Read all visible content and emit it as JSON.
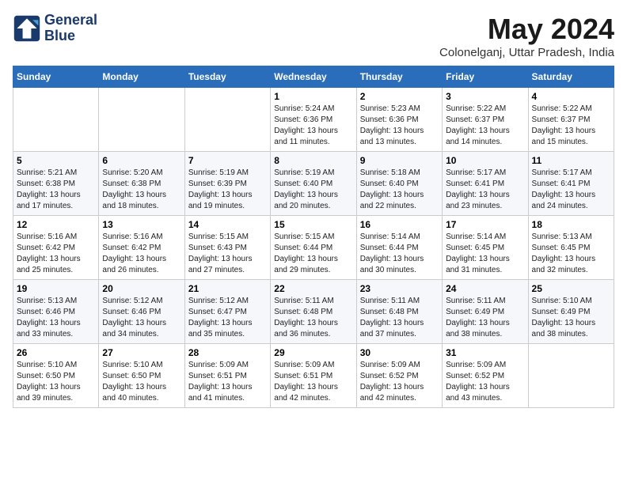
{
  "header": {
    "logo_line1": "General",
    "logo_line2": "Blue",
    "month_title": "May 2024",
    "location": "Colonelganj, Uttar Pradesh, India"
  },
  "days_of_week": [
    "Sunday",
    "Monday",
    "Tuesday",
    "Wednesday",
    "Thursday",
    "Friday",
    "Saturday"
  ],
  "weeks": [
    [
      {
        "day": "",
        "info": ""
      },
      {
        "day": "",
        "info": ""
      },
      {
        "day": "",
        "info": ""
      },
      {
        "day": "1",
        "info": "Sunrise: 5:24 AM\nSunset: 6:36 PM\nDaylight: 13 hours and 11 minutes."
      },
      {
        "day": "2",
        "info": "Sunrise: 5:23 AM\nSunset: 6:36 PM\nDaylight: 13 hours and 13 minutes."
      },
      {
        "day": "3",
        "info": "Sunrise: 5:22 AM\nSunset: 6:37 PM\nDaylight: 13 hours and 14 minutes."
      },
      {
        "day": "4",
        "info": "Sunrise: 5:22 AM\nSunset: 6:37 PM\nDaylight: 13 hours and 15 minutes."
      }
    ],
    [
      {
        "day": "5",
        "info": "Sunrise: 5:21 AM\nSunset: 6:38 PM\nDaylight: 13 hours and 17 minutes."
      },
      {
        "day": "6",
        "info": "Sunrise: 5:20 AM\nSunset: 6:38 PM\nDaylight: 13 hours and 18 minutes."
      },
      {
        "day": "7",
        "info": "Sunrise: 5:19 AM\nSunset: 6:39 PM\nDaylight: 13 hours and 19 minutes."
      },
      {
        "day": "8",
        "info": "Sunrise: 5:19 AM\nSunset: 6:40 PM\nDaylight: 13 hours and 20 minutes."
      },
      {
        "day": "9",
        "info": "Sunrise: 5:18 AM\nSunset: 6:40 PM\nDaylight: 13 hours and 22 minutes."
      },
      {
        "day": "10",
        "info": "Sunrise: 5:17 AM\nSunset: 6:41 PM\nDaylight: 13 hours and 23 minutes."
      },
      {
        "day": "11",
        "info": "Sunrise: 5:17 AM\nSunset: 6:41 PM\nDaylight: 13 hours and 24 minutes."
      }
    ],
    [
      {
        "day": "12",
        "info": "Sunrise: 5:16 AM\nSunset: 6:42 PM\nDaylight: 13 hours and 25 minutes."
      },
      {
        "day": "13",
        "info": "Sunrise: 5:16 AM\nSunset: 6:42 PM\nDaylight: 13 hours and 26 minutes."
      },
      {
        "day": "14",
        "info": "Sunrise: 5:15 AM\nSunset: 6:43 PM\nDaylight: 13 hours and 27 minutes."
      },
      {
        "day": "15",
        "info": "Sunrise: 5:15 AM\nSunset: 6:44 PM\nDaylight: 13 hours and 29 minutes."
      },
      {
        "day": "16",
        "info": "Sunrise: 5:14 AM\nSunset: 6:44 PM\nDaylight: 13 hours and 30 minutes."
      },
      {
        "day": "17",
        "info": "Sunrise: 5:14 AM\nSunset: 6:45 PM\nDaylight: 13 hours and 31 minutes."
      },
      {
        "day": "18",
        "info": "Sunrise: 5:13 AM\nSunset: 6:45 PM\nDaylight: 13 hours and 32 minutes."
      }
    ],
    [
      {
        "day": "19",
        "info": "Sunrise: 5:13 AM\nSunset: 6:46 PM\nDaylight: 13 hours and 33 minutes."
      },
      {
        "day": "20",
        "info": "Sunrise: 5:12 AM\nSunset: 6:46 PM\nDaylight: 13 hours and 34 minutes."
      },
      {
        "day": "21",
        "info": "Sunrise: 5:12 AM\nSunset: 6:47 PM\nDaylight: 13 hours and 35 minutes."
      },
      {
        "day": "22",
        "info": "Sunrise: 5:11 AM\nSunset: 6:48 PM\nDaylight: 13 hours and 36 minutes."
      },
      {
        "day": "23",
        "info": "Sunrise: 5:11 AM\nSunset: 6:48 PM\nDaylight: 13 hours and 37 minutes."
      },
      {
        "day": "24",
        "info": "Sunrise: 5:11 AM\nSunset: 6:49 PM\nDaylight: 13 hours and 38 minutes."
      },
      {
        "day": "25",
        "info": "Sunrise: 5:10 AM\nSunset: 6:49 PM\nDaylight: 13 hours and 38 minutes."
      }
    ],
    [
      {
        "day": "26",
        "info": "Sunrise: 5:10 AM\nSunset: 6:50 PM\nDaylight: 13 hours and 39 minutes."
      },
      {
        "day": "27",
        "info": "Sunrise: 5:10 AM\nSunset: 6:50 PM\nDaylight: 13 hours and 40 minutes."
      },
      {
        "day": "28",
        "info": "Sunrise: 5:09 AM\nSunset: 6:51 PM\nDaylight: 13 hours and 41 minutes."
      },
      {
        "day": "29",
        "info": "Sunrise: 5:09 AM\nSunset: 6:51 PM\nDaylight: 13 hours and 42 minutes."
      },
      {
        "day": "30",
        "info": "Sunrise: 5:09 AM\nSunset: 6:52 PM\nDaylight: 13 hours and 42 minutes."
      },
      {
        "day": "31",
        "info": "Sunrise: 5:09 AM\nSunset: 6:52 PM\nDaylight: 13 hours and 43 minutes."
      },
      {
        "day": "",
        "info": ""
      }
    ]
  ]
}
